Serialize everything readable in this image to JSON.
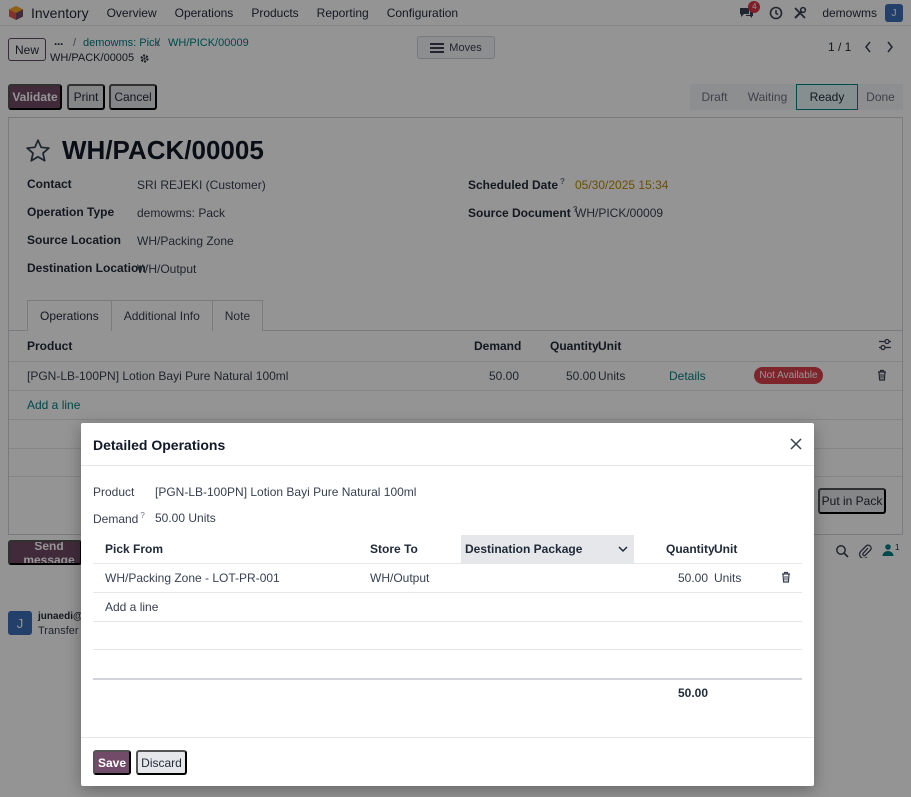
{
  "navbar": {
    "app_name": "Inventory",
    "menu": [
      "Overview",
      "Operations",
      "Products",
      "Reporting",
      "Configuration"
    ],
    "chat_count": "4",
    "db_name": "demowms",
    "avatar_letter": "J"
  },
  "control": {
    "new_label": "New",
    "breadcrumbs": [
      "demowms: Pick",
      "WH/PICK/00009"
    ],
    "record_name": "WH/PACK/00005",
    "moves_label": "Moves",
    "pager": "1 / 1"
  },
  "actions": {
    "validate": "Validate",
    "print": "Print",
    "cancel": "Cancel",
    "statuses": [
      "Draft",
      "Waiting",
      "Ready",
      "Done"
    ],
    "active_status": "Ready"
  },
  "form": {
    "title": "WH/PACK/00005",
    "fields_left": [
      {
        "label": "Contact",
        "value": "SRI REJEKI (Customer)"
      },
      {
        "label": "Operation Type",
        "value": "demowms: Pack"
      },
      {
        "label": "Source Location",
        "value": "WH/Packing Zone"
      },
      {
        "label": "Destination Location",
        "value": "WH/Output"
      }
    ],
    "fields_right": [
      {
        "label": "Scheduled Date",
        "help": "?",
        "value": "05/30/2025 15:34"
      },
      {
        "label": "Source Document",
        "help": "?",
        "value": "WH/PICK/00009"
      }
    ],
    "tabs": [
      "Operations",
      "Additional Info",
      "Note"
    ],
    "table": {
      "headers": [
        "Product",
        "Demand",
        "Quantity",
        "Unit"
      ],
      "rows": [
        {
          "product": "[PGN-LB-100PN] Lotion Bayi Pure Natural 100ml",
          "demand": "50.00",
          "quantity": "50.00",
          "unit": "Units",
          "details": "Details",
          "status": "Not Available"
        }
      ],
      "add_line": "Add a line"
    },
    "put_in_pack": "Put in Pack"
  },
  "chatter": {
    "send_message": "Send message",
    "follower_count": "1",
    "author": "junaedi@a",
    "text": "Transfer c",
    "avatar_letter": "J"
  },
  "modal": {
    "title": "Detailed Operations",
    "product_label": "Product",
    "product_value": "[PGN-LB-100PN] Lotion Bayi Pure Natural 100ml",
    "demand_label": "Demand",
    "demand_help": "?",
    "demand_value": "50.00 Units",
    "headers": [
      "Pick From",
      "Store To",
      "Destination Package",
      "Quantity",
      "Unit"
    ],
    "rows": [
      {
        "pick_from": "WH/Packing Zone - LOT-PR-001",
        "store_to": "WH/Output",
        "package": "",
        "quantity": "50.00",
        "unit": "Units"
      }
    ],
    "add_line": "Add a line",
    "total": "50.00",
    "save": "Save",
    "discard": "Discard"
  },
  "colors": {
    "primary": "#714b67",
    "link": "#017e84",
    "danger": "#d9414b"
  }
}
